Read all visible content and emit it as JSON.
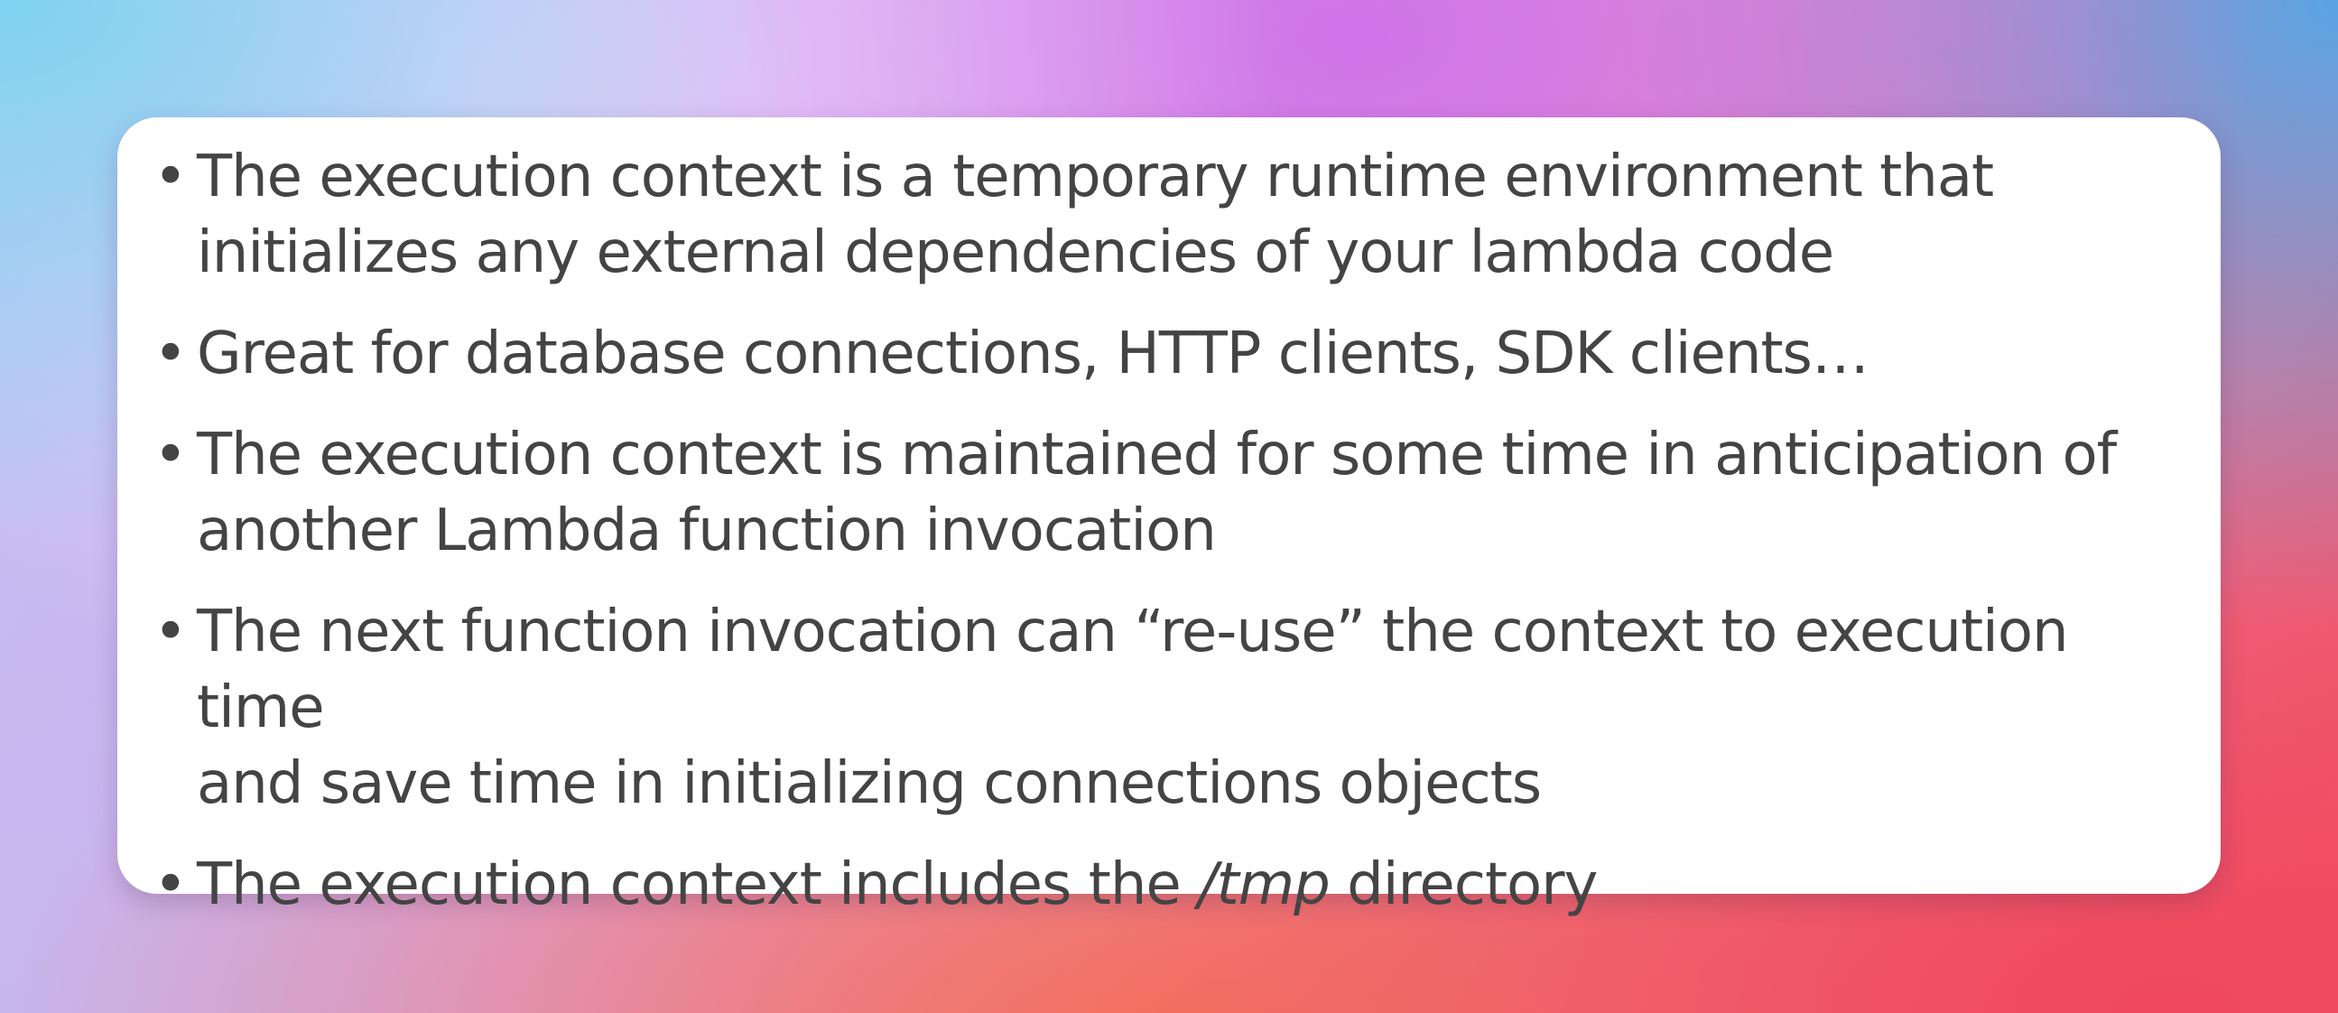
{
  "slide": {
    "bullets": [
      {
        "lines": [
          "The execution context is a temporary runtime environment that",
          "initializes any external dependencies of your lambda code"
        ]
      },
      {
        "lines": [
          "Great for database connections, HTTP clients, SDK clients…"
        ]
      },
      {
        "lines": [
          "The execution context is maintained for some time in anticipation of",
          "another Lambda function invocation"
        ]
      },
      {
        "lines": [
          "The next function invocation can “re-use” the context to execution time",
          "and save time in initializing connections objects"
        ]
      },
      {
        "before": "The execution context includes the ",
        "emphasis": "/tmp",
        "after": " directory"
      }
    ]
  }
}
